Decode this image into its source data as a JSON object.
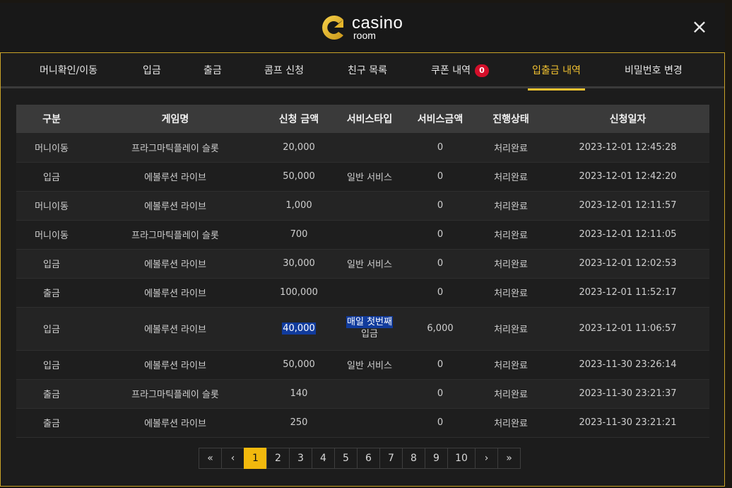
{
  "brand": {
    "line1": "casino",
    "line2": "room"
  },
  "close_label": "×",
  "tabs": [
    {
      "label": "머니확인/이동"
    },
    {
      "label": "입금"
    },
    {
      "label": "출금"
    },
    {
      "label": "콤프 신청"
    },
    {
      "label": "친구 목록"
    },
    {
      "label": "쿠폰 내역",
      "badge": "0"
    },
    {
      "label": "입출금 내역",
      "active": true
    },
    {
      "label": "비밀번호 변경"
    }
  ],
  "table": {
    "headers": [
      "구분",
      "게임명",
      "신청 금액",
      "서비스타입",
      "서비스금액",
      "진행상태",
      "신청일자"
    ],
    "rows": [
      {
        "type": "머니이동",
        "game": "프라그마틱플레이 슬롯",
        "amount": "20,000",
        "service": "",
        "service_amount": "0",
        "status": "처리완료",
        "date": "2023-12-01 12:45:28"
      },
      {
        "type": "입금",
        "game": "에볼루션 라이브",
        "amount": "50,000",
        "service": "일반 서비스",
        "service_amount": "0",
        "status": "처리완료",
        "date": "2023-12-01 12:42:20"
      },
      {
        "type": "머니이동",
        "game": "에볼루션 라이브",
        "amount": "1,000",
        "service": "",
        "service_amount": "0",
        "status": "처리완료",
        "date": "2023-12-01 12:11:57"
      },
      {
        "type": "머니이동",
        "game": "프라그마틱플레이 슬롯",
        "amount": "700",
        "service": "",
        "service_amount": "0",
        "status": "처리완료",
        "date": "2023-12-01 12:11:05"
      },
      {
        "type": "입금",
        "game": "에볼루션 라이브",
        "amount": "30,000",
        "service": "일반 서비스",
        "service_amount": "0",
        "status": "처리완료",
        "date": "2023-12-01 12:02:53"
      },
      {
        "type": "출금",
        "game": "에볼루션 라이브",
        "amount": "100,000",
        "service": "",
        "service_amount": "0",
        "status": "처리완료",
        "date": "2023-12-01 11:52:17"
      },
      {
        "type": "입금",
        "game": "에볼루션 라이브",
        "amount": "40,000",
        "service_line1": "매일 첫번째",
        "service_line2": "입금",
        "service_amount": "6,000",
        "status": "처리완료",
        "date": "2023-12-01 11:06:57"
      },
      {
        "type": "입금",
        "game": "에볼루션 라이브",
        "amount": "50,000",
        "service": "일반 서비스",
        "service_amount": "0",
        "status": "처리완료",
        "date": "2023-11-30 23:26:14"
      },
      {
        "type": "출금",
        "game": "프라그마틱플레이 슬롯",
        "amount": "140",
        "service": "",
        "service_amount": "0",
        "status": "처리완료",
        "date": "2023-11-30 23:21:37"
      },
      {
        "type": "출금",
        "game": "에볼루션 라이브",
        "amount": "250",
        "service": "",
        "service_amount": "0",
        "status": "처리완료",
        "date": "2023-11-30 23:21:21"
      }
    ]
  },
  "pagination": {
    "first": "«",
    "prev": "‹",
    "next": "›",
    "last": "»",
    "pages": [
      "1",
      "2",
      "3",
      "4",
      "5",
      "6",
      "7",
      "8",
      "9",
      "10"
    ],
    "current": "1"
  },
  "colors": {
    "accent": "#f2c230",
    "badge": "#d40f2a",
    "selection": "#113b9c",
    "border": "#c9a227"
  }
}
